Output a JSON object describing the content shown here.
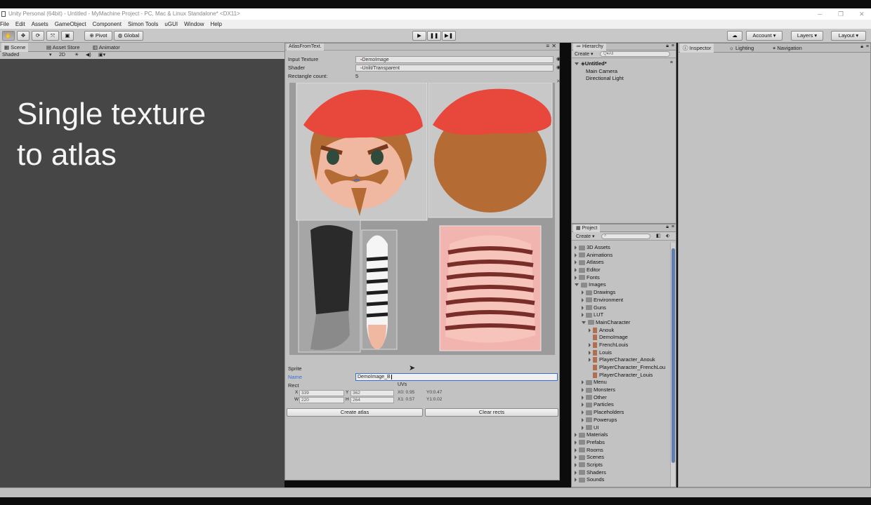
{
  "window": {
    "title": "Unity Personal (64bit) - Untitled - MyMachine Project - PC, Mac & Linux Standalone* <DX11>"
  },
  "menu": [
    "File",
    "Edit",
    "Assets",
    "GameObject",
    "Component",
    "Simon Tools",
    "uGUI",
    "Window",
    "Help"
  ],
  "toolbar": {
    "pivot_label": "Pivot",
    "global_label": "Global",
    "account_label": "Account",
    "layers_label": "Layers",
    "layout_label": "Layout"
  },
  "scene": {
    "tabs": [
      "Scene",
      "Asset Store",
      "Animator"
    ],
    "shading_mode": "Shaded",
    "mode_2d": "2D",
    "overlay_title_line1": "Single texture",
    "overlay_title_line2": "to atlas"
  },
  "atlas": {
    "tab_title": "AtlasFromText.",
    "input_texture_label": "Input Texture",
    "input_texture_value": "DemoImage",
    "shader_label": "Shader",
    "shader_value": "Unlit/Transparent",
    "rect_count_label": "Rectangle count:",
    "rect_count_value": "5",
    "sprite_label": "Sprite",
    "name_label": "Name",
    "name_value": "DemoImage_B",
    "rect_label": "Rect",
    "uvs_label": "UVs",
    "x_label": "X",
    "x_value": "339",
    "y_label": "Y",
    "y_value": "362",
    "w_label": "W",
    "w_value": "220",
    "h_label": "H",
    "h_value": "264",
    "x0": "X0: 0.95",
    "y0": "Y0:0.47",
    "x1": "X1: 0.57",
    "y1": "Y1:0.02",
    "create_atlas_label": "Create atlas",
    "clear_rects_label": "Clear rects"
  },
  "hierarchy": {
    "tab": "Hierarchy",
    "create_label": "Create",
    "search_placeholder": "Q▾All",
    "scene_name": "Untitled*",
    "items": [
      "Main Camera",
      "Directional Light"
    ]
  },
  "project": {
    "tab": "Project",
    "create_label": "Create",
    "tree": [
      {
        "label": "3D Assets",
        "depth": 0,
        "open": false,
        "kind": "folder"
      },
      {
        "label": "Animations",
        "depth": 0,
        "open": false,
        "kind": "folder"
      },
      {
        "label": "Atlases",
        "depth": 0,
        "open": false,
        "kind": "folder"
      },
      {
        "label": "Editor",
        "depth": 0,
        "open": false,
        "kind": "folder"
      },
      {
        "label": "Fonts",
        "depth": 0,
        "open": false,
        "kind": "folder"
      },
      {
        "label": "Images",
        "depth": 0,
        "open": true,
        "kind": "folder"
      },
      {
        "label": "Drawings",
        "depth": 1,
        "open": false,
        "kind": "folder"
      },
      {
        "label": "Environment",
        "depth": 1,
        "open": false,
        "kind": "folder"
      },
      {
        "label": "Guns",
        "depth": 1,
        "open": false,
        "kind": "folder"
      },
      {
        "label": "LUT",
        "depth": 1,
        "open": false,
        "kind": "folder"
      },
      {
        "label": "MainCharacter",
        "depth": 1,
        "open": true,
        "kind": "folder"
      },
      {
        "label": "Anouk",
        "depth": 2,
        "open": false,
        "kind": "asset"
      },
      {
        "label": "DemoImage",
        "depth": 2,
        "open": null,
        "kind": "asset"
      },
      {
        "label": "FrenchLouis",
        "depth": 2,
        "open": false,
        "kind": "asset"
      },
      {
        "label": "Louis",
        "depth": 2,
        "open": false,
        "kind": "asset"
      },
      {
        "label": "PlayerCharacter_Anouk",
        "depth": 2,
        "open": false,
        "kind": "asset"
      },
      {
        "label": "PlayerCharacter_FrenchLou",
        "depth": 2,
        "open": null,
        "kind": "asset"
      },
      {
        "label": "PlayerCharacter_Louis",
        "depth": 2,
        "open": null,
        "kind": "asset"
      },
      {
        "label": "Menu",
        "depth": 1,
        "open": false,
        "kind": "folder"
      },
      {
        "label": "Monsters",
        "depth": 1,
        "open": false,
        "kind": "folder"
      },
      {
        "label": "Other",
        "depth": 1,
        "open": false,
        "kind": "folder"
      },
      {
        "label": "Particles",
        "depth": 1,
        "open": false,
        "kind": "folder"
      },
      {
        "label": "Placeholders",
        "depth": 1,
        "open": false,
        "kind": "folder"
      },
      {
        "label": "Powerups",
        "depth": 1,
        "open": false,
        "kind": "folder"
      },
      {
        "label": "UI",
        "depth": 1,
        "open": false,
        "kind": "folder"
      },
      {
        "label": "Materials",
        "depth": 0,
        "open": false,
        "kind": "folder"
      },
      {
        "label": "Prefabs",
        "depth": 0,
        "open": false,
        "kind": "folder"
      },
      {
        "label": "Rooms",
        "depth": 0,
        "open": false,
        "kind": "folder"
      },
      {
        "label": "Scenes",
        "depth": 0,
        "open": false,
        "kind": "folder"
      },
      {
        "label": "Scripts",
        "depth": 0,
        "open": false,
        "kind": "folder"
      },
      {
        "label": "Shaders",
        "depth": 0,
        "open": false,
        "kind": "folder"
      },
      {
        "label": "Sounds",
        "depth": 0,
        "open": false,
        "kind": "folder"
      }
    ]
  },
  "inspector": {
    "tabs": [
      "Inspector",
      "Lighting",
      "Navigation"
    ]
  },
  "colors": {
    "scene_bg": "#464646",
    "panel_bg": "#c2c2c2",
    "beret_red": "#e8473c",
    "hair_brown": "#b46b34",
    "skin": "#f0b8a0",
    "shirt_pink": "#f2b4ae",
    "stripe_dark": "#7a2e2a",
    "selection_blue": "#3a6fd8"
  }
}
